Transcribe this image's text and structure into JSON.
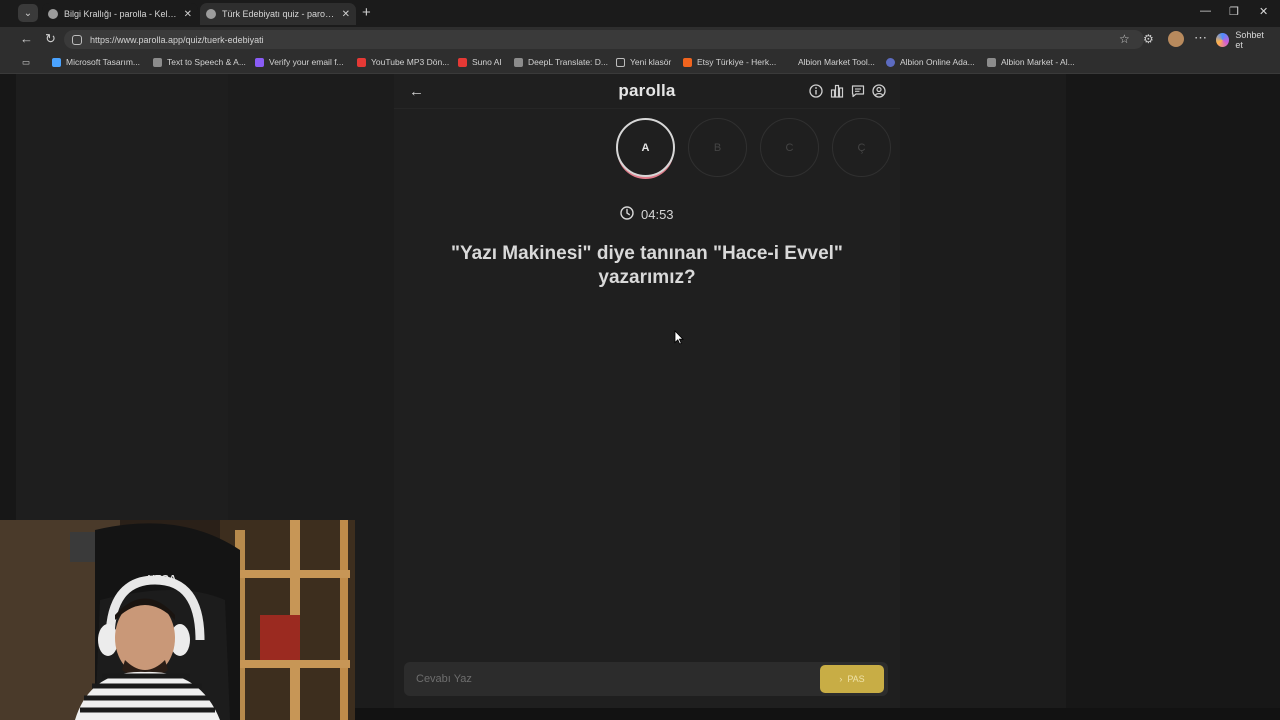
{
  "browser": {
    "tabs": [
      {
        "title": "Bilgi Krallığı - parolla - Kelime oyu",
        "active": false
      },
      {
        "title": "Türk Edebiyatı quiz - parolla - Keli",
        "active": true
      }
    ],
    "url": "https://www.parolla.app/quiz/tuerk-edebiyati",
    "copilot_label": "Sohbet et",
    "bookmarks": [
      {
        "label": "Microsoft Tasarım...",
        "color": "#4aa3ff"
      },
      {
        "label": "Text to Speech & A...",
        "color": "#8c8c8c"
      },
      {
        "label": "Verify your email f...",
        "color": "#8a5cf6"
      },
      {
        "label": "YouTube MP3 Dön...",
        "color": "#e53935"
      },
      {
        "label": "Suno AI",
        "color": "#e53935"
      },
      {
        "label": "DeepL Translate: D...",
        "color": "#8c8c8c"
      },
      {
        "label": "Yeni klasör",
        "color": "#8c8c8c"
      },
      {
        "label": "Etsy Türkiye - Herk...",
        "color": "#f1641e"
      },
      {
        "label": "Albion Market Tool...",
        "color": "#2e2e2e"
      },
      {
        "label": "Albion Online Ada...",
        "color": "#5c6bc0"
      },
      {
        "label": "Albion Market - Al...",
        "color": "#8c8c8c"
      }
    ]
  },
  "app": {
    "logo": "parolla",
    "letters": [
      "A",
      "B",
      "C",
      "Ç"
    ],
    "active_letter": "A",
    "timer": "04:53",
    "question": "\"Yazı Makinesi\" diye tanınan \"Hace-i Evvel\" yazarımız?",
    "answer_placeholder": "Cevabı Yaz",
    "pass_label": "PAS",
    "accent_color": "#c8ad45"
  },
  "icons": {
    "header": [
      "info-icon",
      "stats-icon",
      "comment-icon",
      "user-icon"
    ]
  }
}
